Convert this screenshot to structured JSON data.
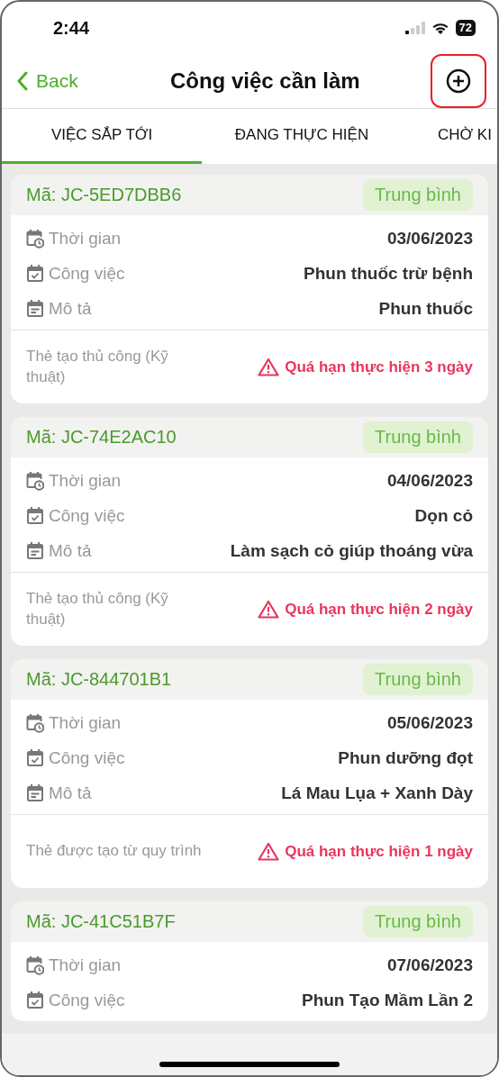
{
  "status_bar": {
    "time": "2:44",
    "battery": "72"
  },
  "nav": {
    "back": "Back",
    "title": "Công việc cần làm",
    "add_highlighted": true
  },
  "tabs": [
    {
      "label": "VIỆC SẮP TỚI",
      "selected": true
    },
    {
      "label": "ĐANG THỰC HIỆN",
      "selected": false
    },
    {
      "label": "CHỜ KI",
      "selected": false
    }
  ],
  "cards": [
    {
      "code": "Mã: JC-5ED7DBB6",
      "priority": "Trung bình",
      "rows": [
        {
          "kind": "time",
          "label": "Thời gian",
          "value": "03/06/2023"
        },
        {
          "kind": "task",
          "label": "Công việc",
          "value": "Phun thuốc trừ bệnh"
        },
        {
          "kind": "desc",
          "label": "Mô tả",
          "value": "Phun thuốc"
        }
      ],
      "source": "Thẻ tạo thủ công (Kỹ thuật)",
      "overdue": "Quá hạn thực hiện 3 ngày"
    },
    {
      "code": "Mã: JC-74E2AC10",
      "priority": "Trung bình",
      "rows": [
        {
          "kind": "time",
          "label": "Thời gian",
          "value": "04/06/2023"
        },
        {
          "kind": "task",
          "label": "Công việc",
          "value": "Dọn cỏ"
        },
        {
          "kind": "desc",
          "label": "Mô tả",
          "value": "Làm sạch cỏ giúp thoáng vừa"
        }
      ],
      "source": "Thẻ tạo thủ công (Kỹ thuật)",
      "overdue": "Quá hạn thực hiện 2 ngày"
    },
    {
      "code": "Mã: JC-844701B1",
      "priority": "Trung bình",
      "rows": [
        {
          "kind": "time",
          "label": "Thời gian",
          "value": "05/06/2023"
        },
        {
          "kind": "task",
          "label": "Công việc",
          "value": "Phun dưỡng đọt"
        },
        {
          "kind": "desc",
          "label": "Mô tả",
          "value": "Lá Mau Lụa + Xanh Dày"
        }
      ],
      "source": "Thẻ được tạo từ quy trình",
      "overdue": "Quá hạn thực hiện 1 ngày"
    },
    {
      "code": "Mã: JC-41C51B7F",
      "priority": "Trung bình",
      "rows": [
        {
          "kind": "time",
          "label": "Thời gian",
          "value": "07/06/2023"
        },
        {
          "kind": "task",
          "label": "Công việc",
          "value": "Phun Tạo Mầm Lần 2"
        }
      ]
    }
  ]
}
